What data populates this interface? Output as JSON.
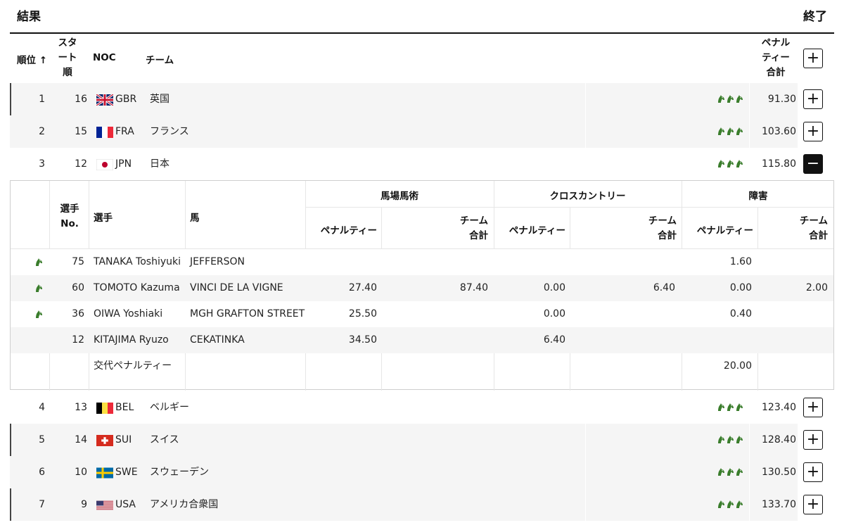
{
  "page": {
    "title": "結果",
    "status": "終了"
  },
  "columns": {
    "rank": "順位 ↑",
    "start_order": "スタ\nート\n順",
    "noc": "NOC",
    "team": "チーム",
    "penalty_total": "ペナル\nティー\n合計"
  },
  "header_toggle": "+",
  "teams": [
    {
      "rank": "1",
      "start": "16",
      "noc": "GBR",
      "team": "英国",
      "penalty": "91.30",
      "toggle": "+",
      "expanded": false
    },
    {
      "rank": "2",
      "start": "15",
      "noc": "FRA",
      "team": "フランス",
      "penalty": "103.60",
      "toggle": "+",
      "expanded": false
    },
    {
      "rank": "3",
      "start": "12",
      "noc": "JPN",
      "team": "日本",
      "penalty": "115.80",
      "toggle": "−",
      "expanded": true
    },
    {
      "rank": "4",
      "start": "13",
      "noc": "BEL",
      "team": "ベルギー",
      "penalty": "123.40",
      "toggle": "+",
      "expanded": false
    },
    {
      "rank": "5",
      "start": "14",
      "noc": "SUI",
      "team": "スイス",
      "penalty": "128.40",
      "toggle": "+",
      "expanded": false
    },
    {
      "rank": "6",
      "start": "10",
      "noc": "SWE",
      "team": "スウェーデン",
      "penalty": "130.50",
      "toggle": "+",
      "expanded": false
    },
    {
      "rank": "7",
      "start": "9",
      "noc": "USA",
      "team": "アメリカ合衆国",
      "penalty": "133.70",
      "toggle": "+",
      "expanded": false
    }
  ],
  "detail": {
    "headers": {
      "athlete_no": "選手\nNo.",
      "athlete": "選手",
      "horse": "馬",
      "dressage": "馬場馬術",
      "cross_country": "クロスカントリー",
      "jumping": "障害",
      "penalty": "ペナルティー",
      "team_total": "チーム\n合計"
    },
    "athletes": [
      {
        "no": "75",
        "name": "TANAKA Toshiyuki",
        "horse": "JEFFERSON",
        "dr_pen": "",
        "dr_tot": "",
        "xc_pen": "",
        "xc_tot": "",
        "sj_pen": "1.60",
        "sj_tot": "",
        "counted": true
      },
      {
        "no": "60",
        "name": "TOMOTO Kazuma",
        "horse": "VINCI DE LA VIGNE",
        "dr_pen": "27.40",
        "dr_tot": "87.40",
        "xc_pen": "0.00",
        "xc_tot": "6.40",
        "sj_pen": "0.00",
        "sj_tot": "2.00",
        "counted": true
      },
      {
        "no": "36",
        "name": "OIWA Yoshiaki",
        "horse": "MGH GRAFTON STREET",
        "dr_pen": "25.50",
        "dr_tot": "",
        "xc_pen": "0.00",
        "xc_tot": "",
        "sj_pen": "0.40",
        "sj_tot": "",
        "counted": true
      },
      {
        "no": "12",
        "name": "KITAJIMA Ryuzo",
        "horse": "CEKATINKA",
        "dr_pen": "34.50",
        "dr_tot": "",
        "xc_pen": "6.40",
        "xc_tot": "",
        "sj_pen": "",
        "sj_tot": "",
        "counted": false
      }
    ],
    "substitution": {
      "label": "交代ペナルティー",
      "sj_pen": "20.00"
    }
  },
  "colors": {
    "horse_icon": "#3a7d2c",
    "row_shade": "#f5f5f5",
    "rule": "#111111"
  }
}
